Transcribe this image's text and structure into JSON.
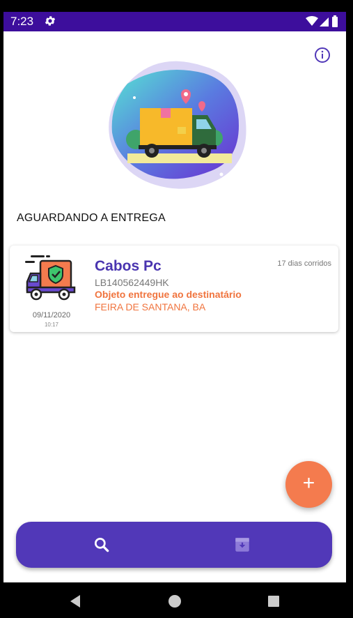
{
  "status_bar": {
    "time": "7:23"
  },
  "section_title": "AGUARDANDO A ENTREGA",
  "card": {
    "name": "Cabos Pc",
    "code": "LB140562449HK",
    "status": "Objeto entregue ao destinatário",
    "city": "FEIRA DE SANTANA, BA",
    "days": "17 dias corridos",
    "date": "09/11/2020",
    "time": "10:17"
  },
  "fab": {
    "label": "+"
  },
  "icons": {
    "info": "info-icon",
    "search": "search-icon",
    "archive": "archive-icon",
    "gear": "gear-icon"
  },
  "colors": {
    "status_bar": "#3d0e9c",
    "primary": "#5138b8",
    "accent": "#f47b4e",
    "title": "#4a35b0"
  }
}
